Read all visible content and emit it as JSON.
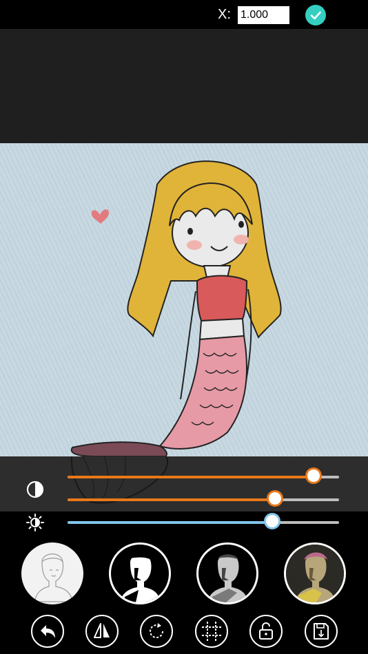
{
  "header": {
    "x_label": "X:",
    "x_value": "1.000",
    "confirm_icon": "check-icon",
    "confirm_color": "#34cfc0"
  },
  "adjustments": {
    "contrast_icon": "contrast-icon",
    "brightness_icon": "brightness-icon",
    "sliders": [
      {
        "name": "contrast-slider",
        "value": 0.905,
        "color": "#e8781a"
      },
      {
        "name": "saturation-slider",
        "value": 0.765,
        "color": "#e8781a"
      },
      {
        "name": "brightness-slider",
        "value": 0.755,
        "color": "#7fc6ec"
      }
    ]
  },
  "filters": [
    {
      "name": "filter-sketch",
      "icon": "statue-sketch-icon",
      "selected": true
    },
    {
      "name": "filter-black-white",
      "icon": "statue-bw-icon",
      "selected": false
    },
    {
      "name": "filter-gray",
      "icon": "statue-gray-icon",
      "selected": false
    },
    {
      "name": "filter-color",
      "icon": "statue-color-icon",
      "selected": false
    }
  ],
  "toolbar": [
    {
      "name": "undo-button",
      "icon": "undo-icon"
    },
    {
      "name": "flip-button",
      "icon": "flip-icon"
    },
    {
      "name": "rotate-button",
      "icon": "rotate-icon"
    },
    {
      "name": "crop-button",
      "icon": "crop-icon"
    },
    {
      "name": "lock-button",
      "icon": "unlock-icon"
    },
    {
      "name": "save-button",
      "icon": "save-icon"
    }
  ]
}
